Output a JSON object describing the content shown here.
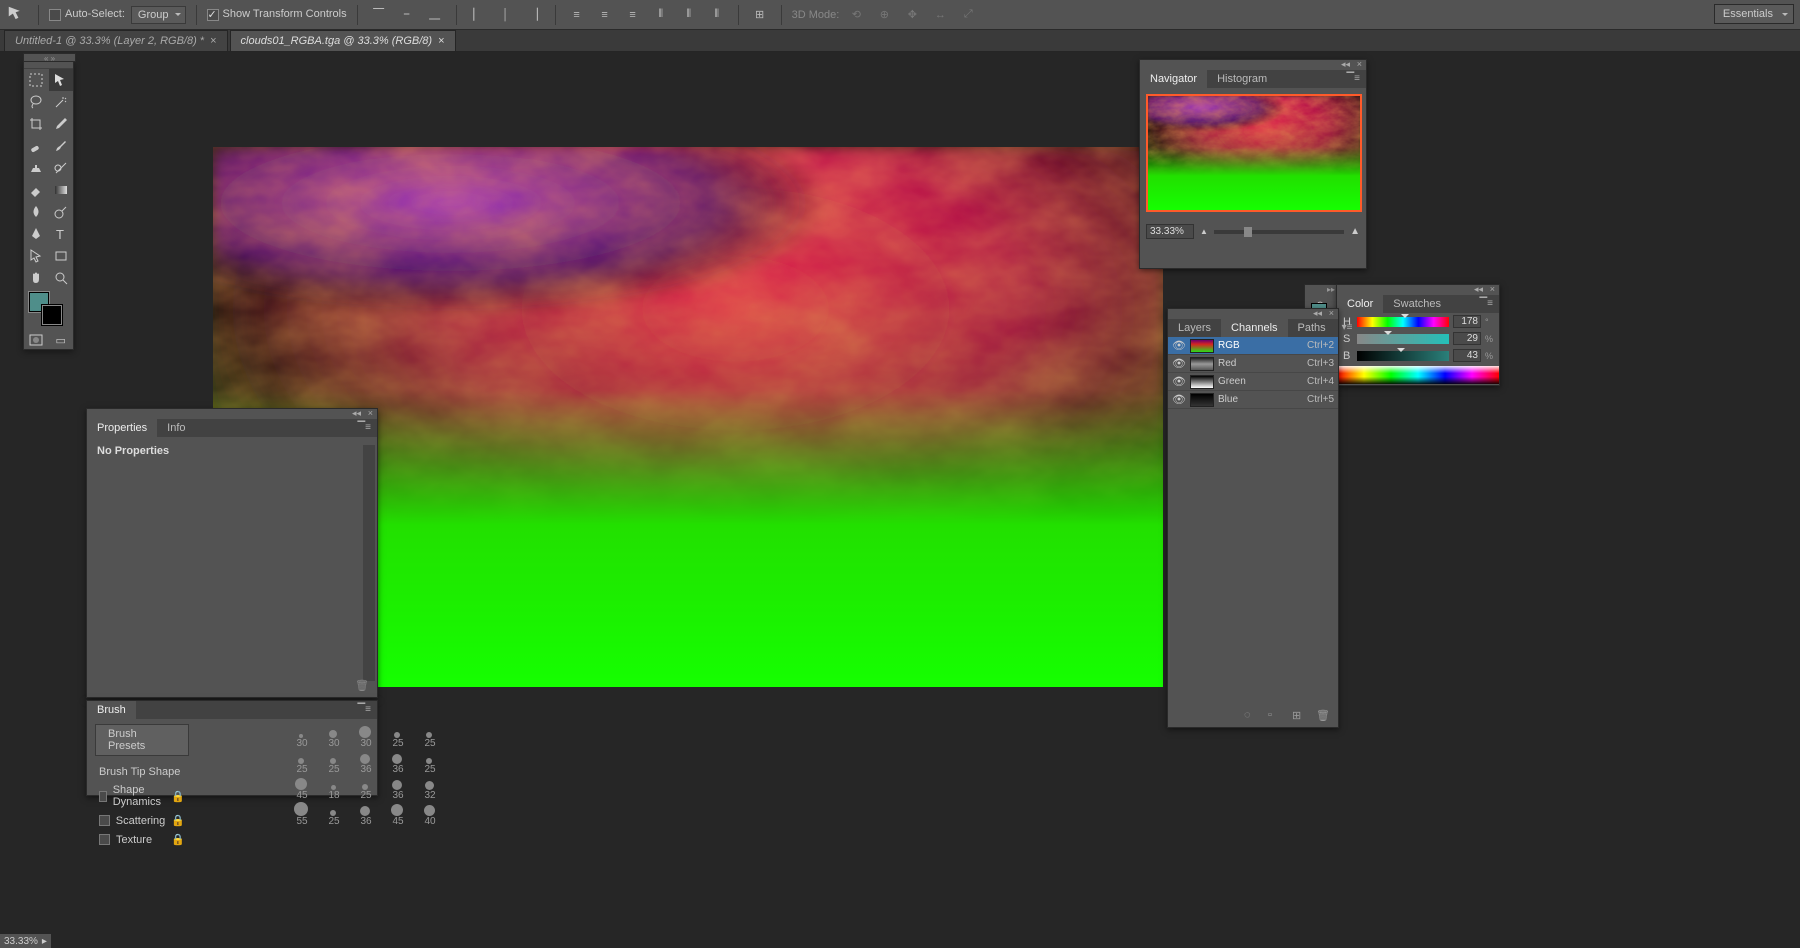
{
  "options_bar": {
    "auto_select_label": "Auto-Select:",
    "auto_select_value": "Group",
    "auto_select_checked": false,
    "transform_label": "Show Transform Controls",
    "transform_checked": true,
    "mode_3d_label": "3D Mode:"
  },
  "workspace_switcher": "Essentials",
  "tabs": [
    {
      "label": "Untitled-1 @ 33.3% (Layer 2, RGB/8) *",
      "active": false
    },
    {
      "label": "clouds01_RGBA.tga @ 33.3% (RGB/8)",
      "active": true
    }
  ],
  "navigator": {
    "tab_navigator": "Navigator",
    "tab_histogram": "Histogram",
    "zoom_value": "33.33%"
  },
  "properties": {
    "tab_properties": "Properties",
    "tab_info": "Info",
    "empty_text": "No Properties"
  },
  "brush": {
    "tab_label": "Brush",
    "presets_btn": "Brush Presets",
    "items": [
      "Brush Tip Shape",
      "Shape Dynamics",
      "Scattering",
      "Texture"
    ],
    "size_row1": [
      "30",
      "30",
      "30",
      "25",
      "25"
    ],
    "size_row2": [
      "25",
      "25",
      "36",
      "36",
      "25"
    ],
    "size_row3": [
      "45",
      "18",
      "25",
      "36",
      "32"
    ],
    "size_row4": [
      "55",
      "25",
      "36",
      "45",
      "40"
    ]
  },
  "channels": {
    "tab_layers": "Layers",
    "tab_channels": "Channels",
    "tab_paths": "Paths",
    "rows": [
      {
        "name": "RGB",
        "shortcut": "Ctrl+2",
        "sel": true,
        "thumb_bg": "linear-gradient(180deg,#6a0070 0%,#d62323 35%,#2bdc1a 100%)"
      },
      {
        "name": "Red",
        "shortcut": "Ctrl+3",
        "sel": false,
        "thumb_bg": "linear-gradient(180deg,#222,#999,#555)"
      },
      {
        "name": "Green",
        "shortcut": "Ctrl+4",
        "sel": false,
        "thumb_bg": "linear-gradient(180deg,#000,#fff)"
      },
      {
        "name": "Blue",
        "shortcut": "Ctrl+5",
        "sel": false,
        "thumb_bg": "linear-gradient(180deg,#000,#333)"
      }
    ]
  },
  "color": {
    "tab_color": "Color",
    "tab_swatches": "Swatches",
    "h_label": "H",
    "s_label": "S",
    "b_label": "B",
    "h_val": "178",
    "s_val": "29",
    "b_val": "43",
    "deg": "°",
    "pct": "%",
    "fg": "#4f8e8a",
    "bg": "#000000"
  },
  "status_zoom": "33.33%"
}
